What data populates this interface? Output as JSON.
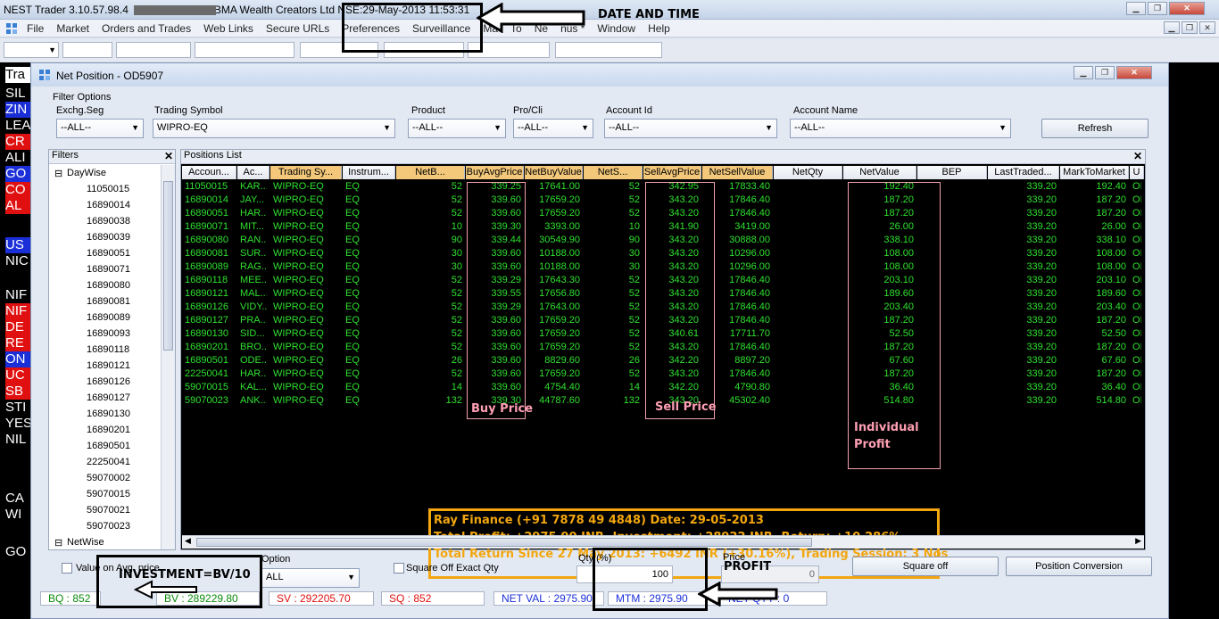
{
  "app": {
    "title_prefix": "NEST Trader 3.10.57.98.4",
    "title_firm": "BMA Wealth Creators Ltd",
    "title_datetime": "NSE:29-May-2013 11:53:31"
  },
  "menu": [
    "File",
    "Market",
    "Orders and Trades",
    "Web Links",
    "Secure URLs",
    "Preferences",
    "Surveillance",
    "Ma",
    "To",
    "Ne",
    "nus *",
    "Window",
    "Help"
  ],
  "market_watch": {
    "header": "Tra",
    "items": [
      {
        "label": "SIL",
        "color": "#000000"
      },
      {
        "label": "ZIN",
        "color": "#1a2fd8"
      },
      {
        "label": "LEA",
        "color": "#000000"
      },
      {
        "label": "CR",
        "color": "#e01010"
      },
      {
        "label": "ALI",
        "color": "#000000"
      },
      {
        "label": "GO",
        "color": "#1a2fd8"
      },
      {
        "label": "CO",
        "color": "#e01010"
      },
      {
        "label": "AL",
        "color": "#e01010"
      },
      {
        "label": "US",
        "color": "#1a2fd8"
      },
      {
        "label": "NIC",
        "color": "#000000"
      },
      {
        "label": "NIF",
        "color": "#000000"
      },
      {
        "label": "NIF",
        "color": "#e01010"
      },
      {
        "label": "DE",
        "color": "#e01010"
      },
      {
        "label": "RE",
        "color": "#e01010"
      },
      {
        "label": "ON",
        "color": "#1a2fd8"
      },
      {
        "label": "UC",
        "color": "#e01010"
      },
      {
        "label": "SB",
        "color": "#e01010"
      },
      {
        "label": "STI",
        "color": "#000000"
      },
      {
        "label": "YES",
        "color": "#000000"
      },
      {
        "label": "NIL",
        "color": "#000000"
      },
      {
        "label": "CA",
        "color": "#000000"
      },
      {
        "label": "WI",
        "color": "#000000"
      },
      {
        "label": "GO",
        "color": "#000000"
      }
    ]
  },
  "net_position": {
    "window_title": "Net Position - OD5907",
    "filter_options_label": "Filter Options",
    "filters": [
      {
        "label": "Exchg.Seg",
        "value": "--ALL--"
      },
      {
        "label": "Trading Symbol",
        "value": "WIPRO-EQ"
      },
      {
        "label": "Product",
        "value": "--ALL--"
      },
      {
        "label": "Pro/Cli",
        "value": "--ALL--"
      },
      {
        "label": "Account Id",
        "value": "--ALL--"
      },
      {
        "label": "Account Name",
        "value": "--ALL--"
      }
    ],
    "refresh_label": "Refresh",
    "filters_panel_title": "Filters",
    "tree_root": "DayWise",
    "tree_accounts": [
      "11050015",
      "16890014",
      "16890038",
      "16890039",
      "16890051",
      "16890071",
      "16890080",
      "16890081",
      "16890089",
      "16890093",
      "16890118",
      "16890121",
      "16890126",
      "16890127",
      "16890130",
      "16890201",
      "16890501",
      "22250041",
      "59070002",
      "59070015",
      "59070021",
      "59070023"
    ],
    "tree_netwise": "NetWise",
    "positions_title": "Positions List",
    "columns": [
      "Accoun...",
      "Ac...",
      "Trading Sy...",
      "Instrum...",
      "NetB...",
      "BuyAvgPrice",
      "NetBuyValue",
      "NetS...",
      "SellAvgPrice",
      "NetSellValue",
      "NetQty",
      "NetValue",
      "BEP",
      "LastTraded...",
      "MarkToMarket",
      "U"
    ],
    "rows": [
      [
        "11050015",
        "KAR...",
        "WIPRO-EQ",
        "EQ",
        "52",
        "339.25",
        "17641.00",
        "52",
        "342.95",
        "17833.40",
        "",
        "192.40",
        "",
        "339.20",
        "192.40",
        "OI"
      ],
      [
        "16890014",
        "JAY...",
        "WIPRO-EQ",
        "EQ",
        "52",
        "339.60",
        "17659.20",
        "52",
        "343.20",
        "17846.40",
        "",
        "187.20",
        "",
        "339.20",
        "187.20",
        "OI"
      ],
      [
        "16890051",
        "HAR...",
        "WIPRO-EQ",
        "EQ",
        "52",
        "339.60",
        "17659.20",
        "52",
        "343.20",
        "17846.40",
        "",
        "187.20",
        "",
        "339.20",
        "187.20",
        "OI"
      ],
      [
        "16890071",
        "MIT...",
        "WIPRO-EQ",
        "EQ",
        "10",
        "339.30",
        "3393.00",
        "10",
        "341.90",
        "3419.00",
        "",
        "26.00",
        "",
        "339.20",
        "26.00",
        "OI"
      ],
      [
        "16890080",
        "RAN...",
        "WIPRO-EQ",
        "EQ",
        "90",
        "339.44",
        "30549.90",
        "90",
        "343.20",
        "30888.00",
        "",
        "338.10",
        "",
        "339.20",
        "338.10",
        "OI"
      ],
      [
        "16890081",
        "SUR...",
        "WIPRO-EQ",
        "EQ",
        "30",
        "339.60",
        "10188.00",
        "30",
        "343.20",
        "10296.00",
        "",
        "108.00",
        "",
        "339.20",
        "108.00",
        "OI"
      ],
      [
        "16890089",
        "RAG...",
        "WIPRO-EQ",
        "EQ",
        "30",
        "339.60",
        "10188.00",
        "30",
        "343.20",
        "10296.00",
        "",
        "108.00",
        "",
        "339.20",
        "108.00",
        "OI"
      ],
      [
        "16890118",
        "MEE...",
        "WIPRO-EQ",
        "EQ",
        "52",
        "339.29",
        "17643.30",
        "52",
        "343.20",
        "17846.40",
        "",
        "203.10",
        "",
        "339.20",
        "203.10",
        "OI"
      ],
      [
        "16890121",
        "MAL...",
        "WIPRO-EQ",
        "EQ",
        "52",
        "339.55",
        "17656.80",
        "52",
        "343.20",
        "17846.40",
        "",
        "189.60",
        "",
        "339.20",
        "189.60",
        "OI"
      ],
      [
        "16890126",
        "VIDY...",
        "WIPRO-EQ",
        "EQ",
        "52",
        "339.29",
        "17643.00",
        "52",
        "343.20",
        "17846.40",
        "",
        "203.40",
        "",
        "339.20",
        "203.40",
        "OI"
      ],
      [
        "16890127",
        "PRA...",
        "WIPRO-EQ",
        "EQ",
        "52",
        "339.60",
        "17659.20",
        "52",
        "343.20",
        "17846.40",
        "",
        "187.20",
        "",
        "339.20",
        "187.20",
        "OI"
      ],
      [
        "16890130",
        "SID...",
        "WIPRO-EQ",
        "EQ",
        "52",
        "339.60",
        "17659.20",
        "52",
        "340.61",
        "17711.70",
        "",
        "52.50",
        "",
        "339.20",
        "52.50",
        "OI"
      ],
      [
        "16890201",
        "BRO...",
        "WIPRO-EQ",
        "EQ",
        "52",
        "339.60",
        "17659.20",
        "52",
        "343.20",
        "17846.40",
        "",
        "187.20",
        "",
        "339.20",
        "187.20",
        "OI"
      ],
      [
        "16890501",
        "ODE...",
        "WIPRO-EQ",
        "EQ",
        "26",
        "339.60",
        "8829.60",
        "26",
        "342.20",
        "8897.20",
        "",
        "67.60",
        "",
        "339.20",
        "67.60",
        "OI"
      ],
      [
        "22250041",
        "HAR...",
        "WIPRO-EQ",
        "EQ",
        "52",
        "339.60",
        "17659.20",
        "52",
        "343.20",
        "17846.40",
        "",
        "187.20",
        "",
        "339.20",
        "187.20",
        "OI"
      ],
      [
        "59070015",
        "KAL...",
        "WIPRO-EQ",
        "EQ",
        "14",
        "339.60",
        "4754.40",
        "14",
        "342.20",
        "4790.80",
        "",
        "36.40",
        "",
        "339.20",
        "36.40",
        "OI"
      ],
      [
        "59070023",
        "ANK...",
        "WIPRO-EQ",
        "EQ",
        "132",
        "339.30",
        "44787.60",
        "132",
        "343.20",
        "45302.40",
        "",
        "514.80",
        "",
        "339.20",
        "514.80",
        "OI"
      ]
    ],
    "bottom": {
      "value_avg_price": "Value on Avg. price",
      "option_label": "Option",
      "option_value": "ALL",
      "square_off_exact": "Square Off Exact Qty",
      "qty_label": "Qty (%)",
      "qty_value": "100",
      "price_label": "Price",
      "price_value": "0",
      "square_off_btn": "Square off",
      "position_conversion_btn": "Position Conversion"
    },
    "status": {
      "bq": "BQ : 852",
      "bv": "BV : 289229.80",
      "sv": "SV : 292205.70",
      "sq": "SQ : 852",
      "net_val": "NET VAL : 2975.90",
      "mtm": "MTM : 2975.90",
      "net_qty": "NET QTY : 0"
    }
  },
  "annotations": {
    "date_and_time": "DATE AND TIME",
    "buy_price": "Buy Price",
    "sell_price": "Sell Price",
    "individual_profit_1": "Individual",
    "individual_profit_2": "Profit",
    "summary_1": "Ray Finance (+91 7878 49 4848) Date: 29-05-2013",
    "summary_2": "Total Profit: +2975.90 INR, Investment: +28922 INR, Return: +10.286%",
    "summary_3": "Total Return Since 27 May 2013: +6492 INR (+30.16%), Trading Session: 3 Nos",
    "investment": "INVESTMENT=BV/10",
    "profit": "PROFIT"
  },
  "colors": {
    "grid_text": "#2fe02f",
    "annotation_pink": "#ff9fb3",
    "summary_orange": "#f2a60f",
    "status_red": "#e01010",
    "status_blue": "#1a2fd8",
    "status_green": "#0a8a0a"
  }
}
